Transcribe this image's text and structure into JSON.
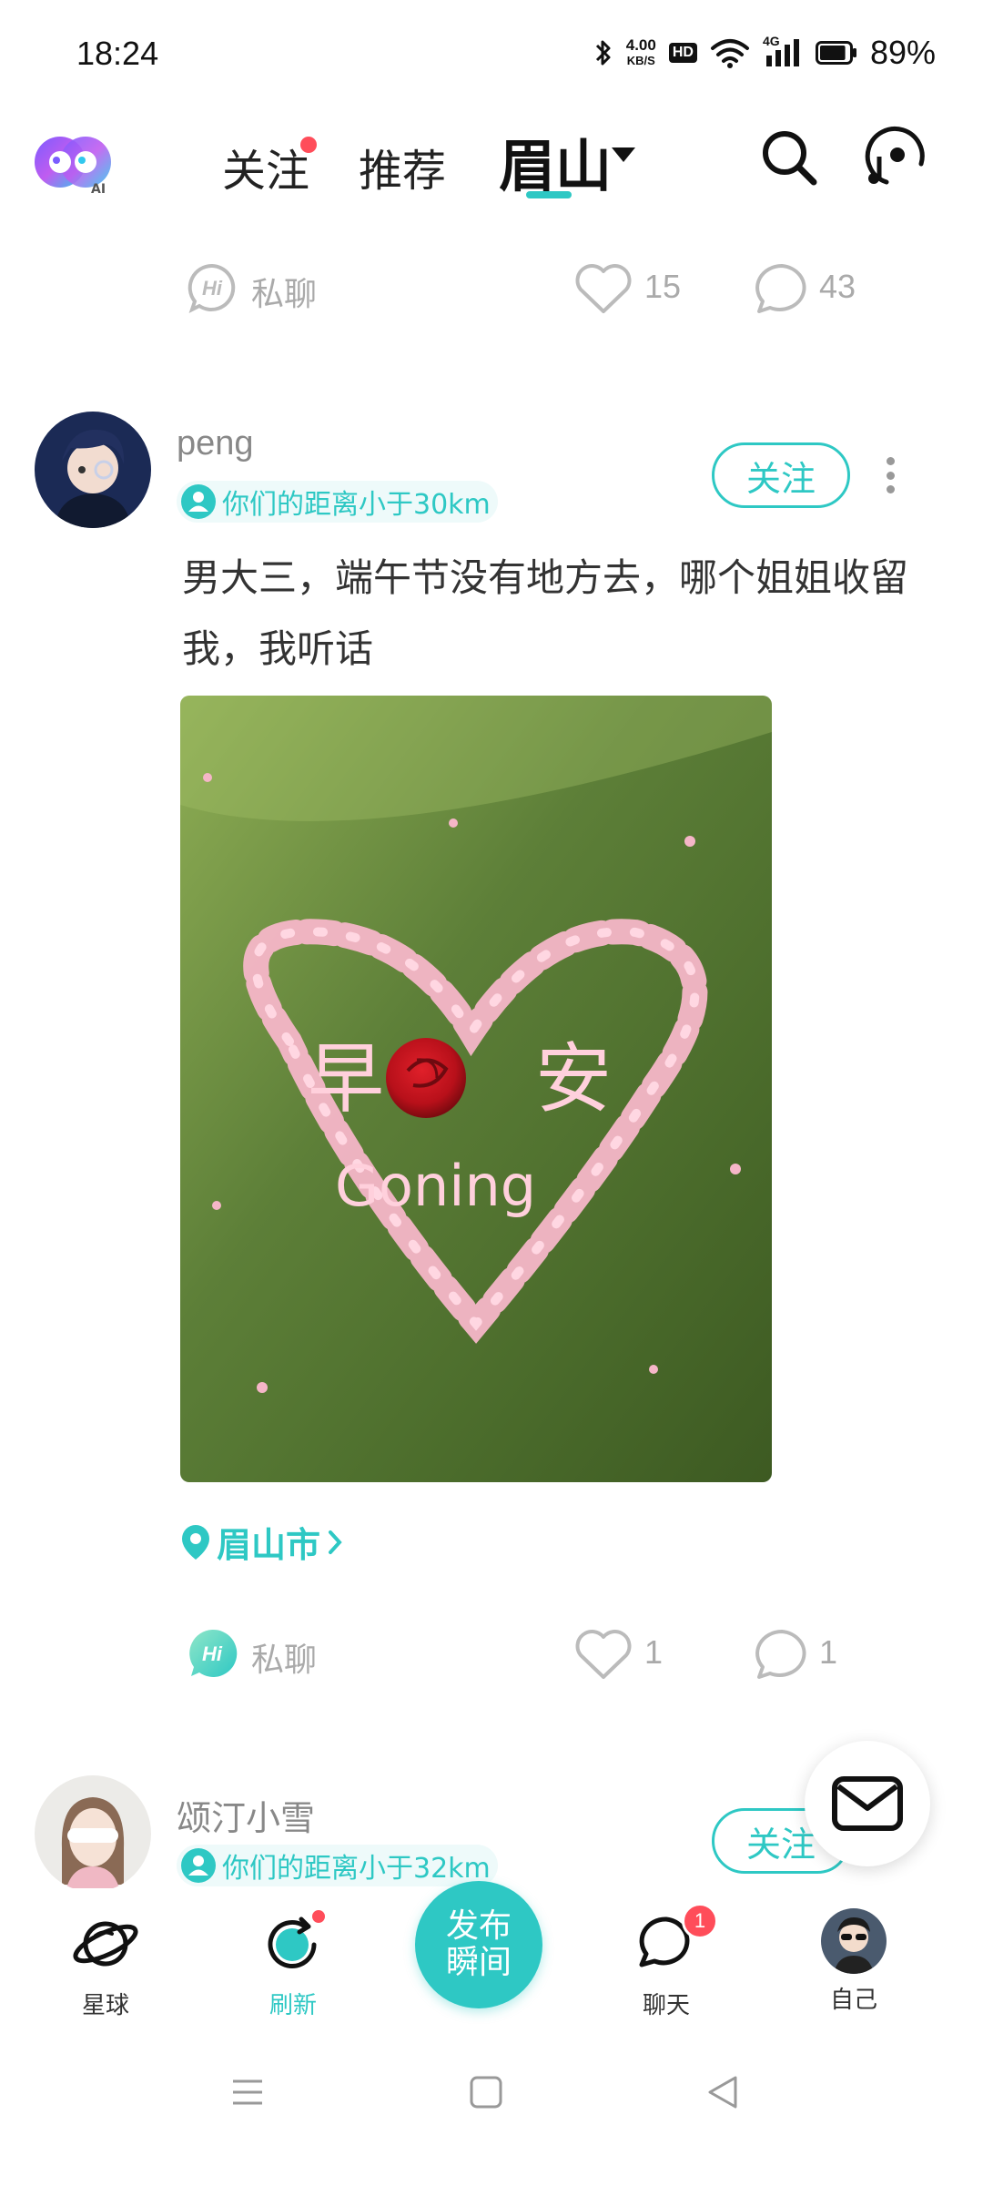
{
  "status_bar": {
    "time": "18:24",
    "net_speed_value": "4.00",
    "net_speed_unit": "KB/S",
    "hd_label": "HD",
    "network_label": "4G",
    "battery_percent": "89%",
    "battery_level": 0.89
  },
  "header": {
    "logo_label": "AI",
    "tabs": [
      {
        "label": "关注",
        "has_dot": true
      },
      {
        "label": "推荐"
      },
      {
        "label": "眉山",
        "active": true,
        "has_dropdown": true
      }
    ],
    "icons": [
      "search-icon",
      "music-note-icon"
    ]
  },
  "prev_post_actions": {
    "chat_label": "私聊",
    "like_count": "15",
    "comment_count": "43"
  },
  "post": {
    "username": "peng",
    "distance": "你们的距离小于30km",
    "follow_label": "关注",
    "text": "男大三，端午节没有地方去，哪个姐姐收留我，我听话",
    "image": {
      "char_left": "早",
      "char_right": "安",
      "word": "Goning"
    },
    "location": "眉山市",
    "actions": {
      "chat_label": "私聊",
      "like_count": "1",
      "comment_count": "1"
    }
  },
  "next_post": {
    "username": "颂汀小雪",
    "distance": "你们的距离小于32km",
    "follow_label": "关注"
  },
  "bottom_nav": {
    "items": [
      {
        "label": "星球",
        "icon": "planet-icon"
      },
      {
        "label": "刷新",
        "icon": "refresh-icon",
        "active": true,
        "has_dot": true
      },
      {
        "label": "聊天",
        "icon": "chat-bubble-icon",
        "badge": "1"
      },
      {
        "label": "自己",
        "icon": "avatar"
      }
    ],
    "publish_line1": "发布",
    "publish_line2": "瞬间"
  },
  "colors": {
    "accent": "#2ec8c4",
    "badge": "#ff4d5a",
    "muted_text": "#aaaaaa"
  }
}
